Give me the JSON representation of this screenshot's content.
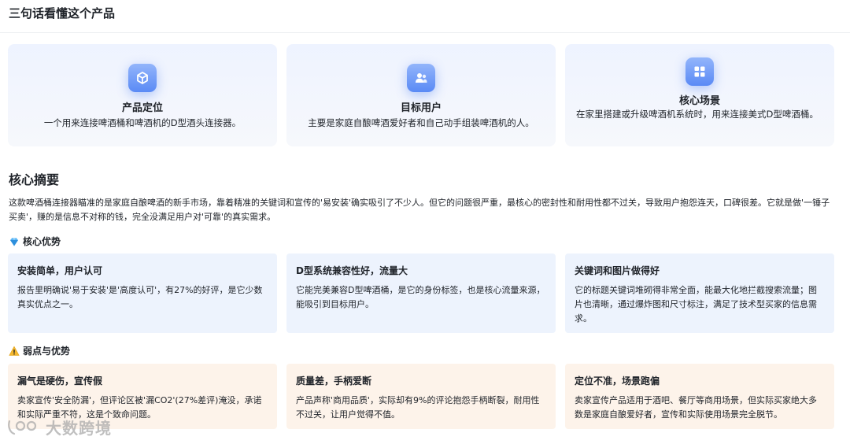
{
  "header": {
    "title": "三句话看懂这个产品"
  },
  "overview": [
    {
      "icon": "cube-icon",
      "title": "产品定位",
      "text": "一个用来连接啤酒桶和啤酒机的D型酒头连接器。"
    },
    {
      "icon": "users-icon",
      "title": "目标用户",
      "text": "主要是家庭自酿啤酒爱好者和自己动手组装啤酒机的人。"
    },
    {
      "icon": "grid-icon",
      "title": "核心场景",
      "text": "在家里搭建或升级啤酒机系统时，用来连接美式D型啤酒桶。"
    }
  ],
  "summary": {
    "title": "核心摘要",
    "text": "这款啤酒桶连接器瞄准的是家庭自酿啤酒的新手市场，靠着精准的关键词和宣传的'易安装'确实吸引了不少人。但它的问题很严重，最核心的密封性和耐用性都不过关，导致用户抱怨连天，口碑很差。它就是做'一锤子买卖'，赚的是信息不对称的钱，完全没满足用户对'可靠'的真实需求。"
  },
  "strengths": {
    "title": "核心优势",
    "icon": "gem-icon",
    "items": [
      {
        "title": "安装简单，用户认可",
        "text": "报告里明确说'易于安装'是'高度认可'，有27%的好评，是它少数真实优点之一。"
      },
      {
        "title": "D型系统兼容性好，流量大",
        "text": "它能完美兼容D型啤酒桶，是它的身份标签，也是核心流量来源，能吸引到目标用户。"
      },
      {
        "title": "关键词和图片做得好",
        "text": "它的标题关键词堆砌得非常全面，能最大化地拦截搜索流量；图片也清晰，通过爆炸图和尺寸标注，满足了技术型买家的信息需求。"
      }
    ]
  },
  "weaknesses": {
    "title": "弱点与优势",
    "icon": "warning-icon",
    "items": [
      {
        "title": "漏气是硬伤，宣传假",
        "text": "卖家宣传'安全防漏'，但评论区被'漏CO2'(27%差评)淹没，承诺和实际严重不符，这是个致命问题。"
      },
      {
        "title": "质量差，手柄爱断",
        "text": "产品声称'商用品质'，实际却有9%的评论抱怨手柄断裂，耐用性不过关，让用户觉得不值。"
      },
      {
        "title": "定位不准，场景跑偏",
        "text": "卖家宣传产品适用于酒吧、餐厅等商用场景，但实际买家绝大多数是家庭自酿爱好者，宣传和实际使用场景完全脱节。"
      }
    ]
  },
  "watermark": {
    "text": "大数跨境"
  },
  "colors": {
    "accent": "#5a8af5",
    "card_blue": "#edf3fd",
    "card_orange": "#fdf3ea"
  }
}
